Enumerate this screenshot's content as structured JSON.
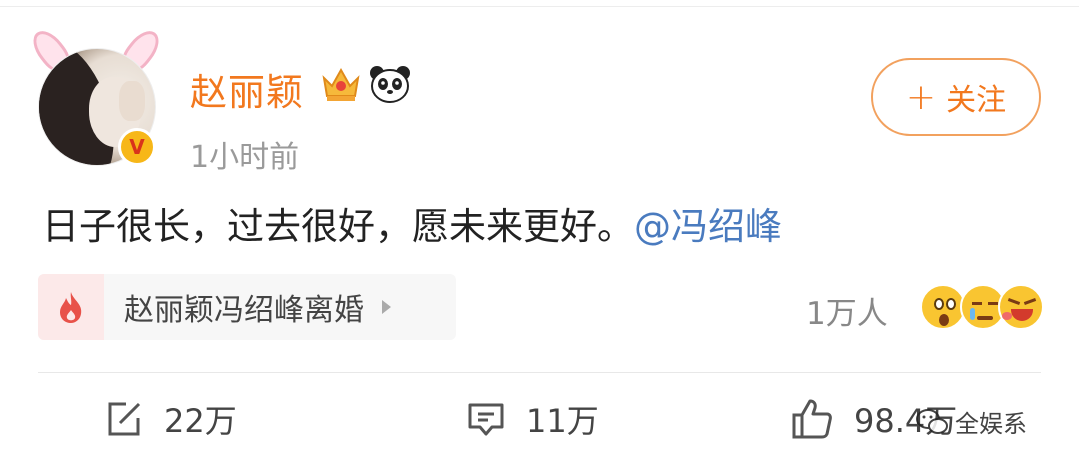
{
  "post": {
    "username": "赵丽颖",
    "timestamp": "1小时前",
    "content_text": "日子很长，过去很好，愿未来更好。",
    "mention": "@冯绍峰",
    "verified_badge": "V"
  },
  "follow": {
    "plus": "+",
    "label": "关注"
  },
  "topic": {
    "label": "赵丽颖冯绍峰离婚"
  },
  "reactions": {
    "count": "1万人"
  },
  "actions": {
    "repost": "22万",
    "comment": "11万",
    "like": "98.4万"
  },
  "watermark": {
    "text": "全娱系"
  },
  "colors": {
    "username": "#f2781e",
    "mention": "#4a7bbf",
    "follow_border": "#f2a15e",
    "topic_fire": "#e8524a"
  }
}
